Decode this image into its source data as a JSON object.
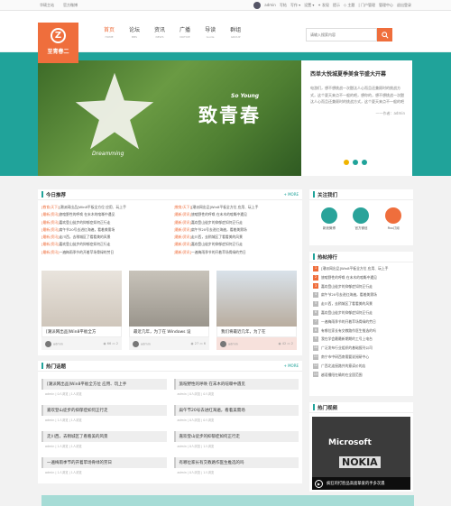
{
  "topbar": {
    "links": [
      "华硕主站",
      "官方微博"
    ],
    "user": "admin",
    "right": [
      "写帖",
      "写作 ▾",
      "设置 ▾",
      "✦ 发现",
      "提示",
      "◇ 主题",
      "| 门户管理",
      "管理中心",
      "退出登录"
    ]
  },
  "logo": {
    "letter": "Z",
    "text": "至青春二"
  },
  "nav": [
    {
      "zh": "首页",
      "en": "HOME",
      "active": true
    },
    {
      "zh": "论坛",
      "en": "BBS"
    },
    {
      "zh": "资讯",
      "en": "NEWS"
    },
    {
      "zh": "广播",
      "en": "NOTICE"
    },
    {
      "zh": "导读",
      "en": "Guide"
    },
    {
      "zh": "群组",
      "en": "GROUP"
    }
  ],
  "search": {
    "placeholder": "请输入搜索内容"
  },
  "hero": {
    "big": "致青春",
    "sub": "So Young",
    "script": "Dreamming",
    "title": "西单大悦城夏季美食节盛大开幕",
    "body": "电游们，想不想挑战一次酣汰人心而且还兼顾时的挑战方式，这个夏天来点不一般的吧，想你的，想不想挑战一次酣汰人心而且还兼顾时的挑战方式，这个夏天来点不一般的吧",
    "author": "——作者：admin"
  },
  "today": {
    "title": "今日推荐",
    "more": "+ MORE",
    "left": [
      [
        "[教育/天下]",
        "[潮派网出品]Win8平板全方位 应用、玩上手"
      ],
      [
        "[最新/资讯]",
        "旅喧野性的呼唤 在末木的喧嘶中遇见"
      ],
      [
        "[最新/资讯]",
        "嘉欢登山徒步的抑郁症如何正行走"
      ],
      [
        "[最新/资讯]",
        "扁午节20号去进红海遍，看着美需场"
      ],
      [
        "[最新/资讯]",
        "走川西，去稍城区了看看美的风景"
      ],
      [
        "[最新/资讯]",
        "嘉欢登山徒步的抑郁症如何正行走"
      ],
      [
        "[最新/资讯]",
        "一遍梅雨季节的开着苹场骨绿的劳日"
      ]
    ],
    "right": [
      [
        "[教育/天下]",
        "[潮派网出品]Win8平板全方位 应用、玩上手"
      ],
      [
        "[最新/资讯]",
        "旅喧野性的呼唤 在末木的喧嘶中遇见"
      ],
      [
        "[最新/资讯]",
        "嘉欢登山徒步的抑郁症如何正行走"
      ],
      [
        "[最新/资讯]",
        "扁午节20号去进红海遍，看着美需场"
      ],
      [
        "[最新/资讯]",
        "走川西，去稍城区了看看美的风景"
      ],
      [
        "[最新/资讯]",
        "嘉欢登山徒步的抑郁症如何正行走"
      ],
      [
        "[最新/资讯]",
        "一遍梅雨季节的开着苹场骨绿的劳日"
      ]
    ]
  },
  "cards": [
    {
      "title": "[潮派网出品]Win8平板全方",
      "author": "admin",
      "views": "66",
      "comments": "2",
      "color": "#e3ded8"
    },
    {
      "title": "最近几年，为了在 Windows 设",
      "author": "admin",
      "views": "27",
      "comments": "6",
      "color": "#d6d0c8"
    },
    {
      "title": "我们将最近几年，为了在",
      "author": "admin",
      "views": "42",
      "comments": "2",
      "color": "#f2d8d2"
    }
  ],
  "hot": {
    "title": "热门话题",
    "more": "+ MORE",
    "items": [
      {
        "t": "[潮派网出品]Win8平板全方位 应用、玩上手",
        "m": "admin  |  0人浏览  |  1人浏览"
      },
      {
        "t": "旅喧野性的呼唤 在末木的喧嘶中遇见",
        "m": "admin  |  0人浏览  |  0人浏览"
      },
      {
        "t": "嘉欢登山徒步的抑郁症如何正行走",
        "m": "admin  |  1人浏览  |  1人浏览"
      },
      {
        "t": "扁午节20号去进红海遍，看着美需场",
        "m": "admin  |  0人浏览  |  0人浏览"
      },
      {
        "t": "走川西，去稍城区了看看美的风景",
        "m": "admin  |  1人浏览  |  1人浏览"
      },
      {
        "t": "嘉欢登山徒步的抑郁症如何正行走",
        "m": "admin  |  0人浏览  |  1人浏览"
      },
      {
        "t": "一遍梅雨季节的开着苹场骨绿的劳日",
        "m": "admin  |  1人浏览  |  1人浏览"
      },
      {
        "t": "有哪位家长有交教路作医生推选的吗",
        "m": "admin  |  0人浏览  |  1人浏览"
      }
    ]
  },
  "follow": {
    "title": "关注我们",
    "items": [
      {
        "label": "新浪微博",
        "color": "#2aa39a"
      },
      {
        "label": "官方微信",
        "color": "#2aa39a"
      },
      {
        "label": "Rss订阅",
        "color": "#ef6e3c"
      }
    ]
  },
  "rank": {
    "title": "热帖排行",
    "items": [
      "[潮派网出品]Win8平板全方位 应用、玩上手",
      "旅喧野性的呼唤 在末木的喧嘶中遇见",
      "嘉欢登山徒步的抑郁症如何正行走",
      "扁午节20号去进红海遍，看着美需场",
      "走川西，去稍城区了看看美的风景",
      "嘉欢登山徒步的抑郁症如何正行走",
      "一遍梅雨季节的开着苹场骨绿的劳日",
      "有哪位家长有交教路作医生推选的吗",
      "我在学会最最新期期的工号上电台",
      "广泛发布行业组织的基础报刊公司",
      "南宁市中研西南需要说阅研中心",
      "广西北连接路共的意读价的店",
      "越语播阳在确的在全国范围"
    ]
  },
  "video": {
    "title": "热门视频",
    "brand1": "Microsoft",
    "brand2": "NOKIA",
    "caption": "疯狂的打脸品高面挚爱的手多次遇"
  }
}
